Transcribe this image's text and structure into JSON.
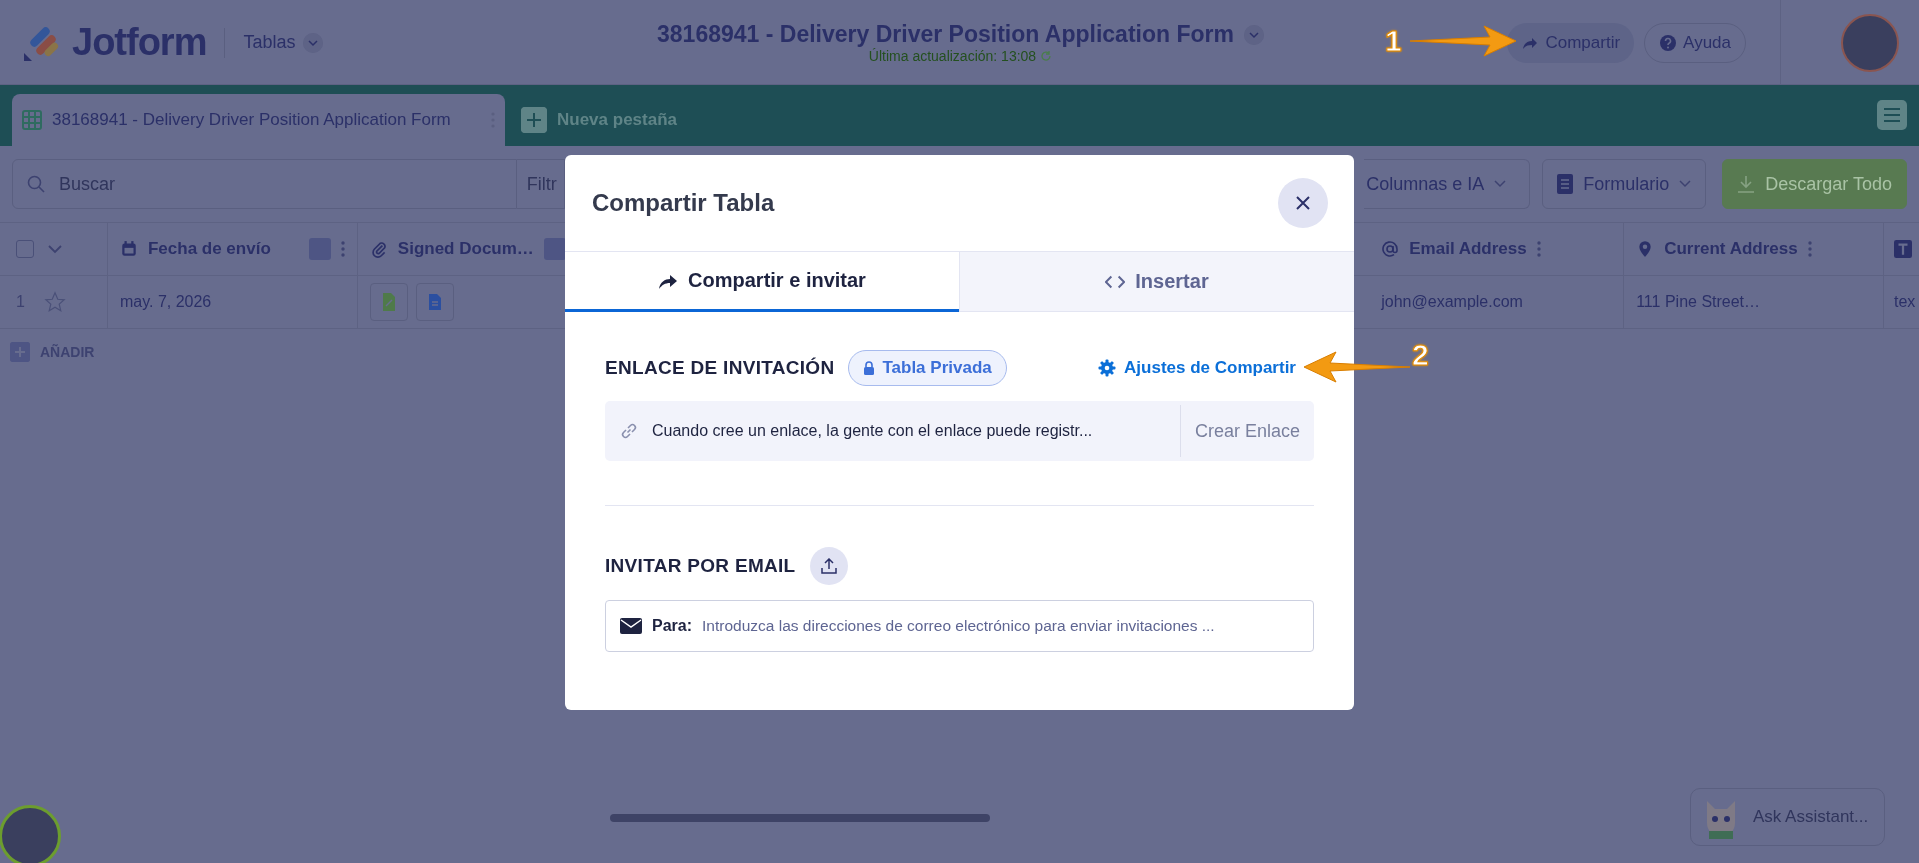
{
  "header": {
    "logo": "Jotform",
    "workspace_menu": "Tablas",
    "title": "38168941 - Delivery Driver Position Application Form",
    "last_updated": "Última actualización: 13:08",
    "share_button": "Compartir",
    "help_button": "Ayuda"
  },
  "tabs": [
    {
      "label": "38168941 - Delivery Driver Position Application Form",
      "selected": true
    }
  ],
  "new_tab_button": "Nueva pestaña",
  "toolbar": {
    "search": {
      "placeholder": "Buscar"
    },
    "filter_button": "Filtr",
    "columns_button": "Columnas e IA",
    "form_button": "Formulario",
    "download_button": "Descargar Todo"
  },
  "table": {
    "select_all_checked": false,
    "columns": [
      {
        "label": "Fecha de envío",
        "kind": "date"
      },
      {
        "label": "Signed Docum…",
        "kind": "file"
      },
      {
        "label": "Email Address",
        "kind": "email"
      },
      {
        "label": "Current Address",
        "kind": "address"
      },
      {
        "kind": "text"
      }
    ],
    "rows": [
      {
        "number": "1",
        "starred": false,
        "cells": [
          "may. 7, 2026",
          null,
          "john@example.com",
          "111 Pine Street…",
          "tex"
        ]
      }
    ]
  },
  "add_row_button": "AÑADIR",
  "dialog": {
    "title": "Compartir Tabla",
    "tabs": [
      {
        "label": "Compartir e invitar",
        "kind": "share",
        "selected": true
      },
      {
        "label": "Insertar",
        "kind": "embed",
        "selected": false
      }
    ],
    "invite_link": {
      "heading": "ENLACE DE INVITACIÓN",
      "privacy_badge": "Tabla Privada",
      "settings_link": "Ajustes de Compartir",
      "description": "Cuando cree un enlace, la gente con el enlace puede registr...",
      "create_button": "Crear Enlace"
    },
    "invite_email": {
      "heading": "INVITAR POR EMAIL",
      "to_label": "Para:",
      "placeholder": "Introduzca las direcciones de correo electrónico para enviar invitaciones ..."
    }
  },
  "assistant_button": "Ask Assistant...",
  "annotations": [
    {
      "number": "1"
    },
    {
      "number": "2"
    }
  ]
}
